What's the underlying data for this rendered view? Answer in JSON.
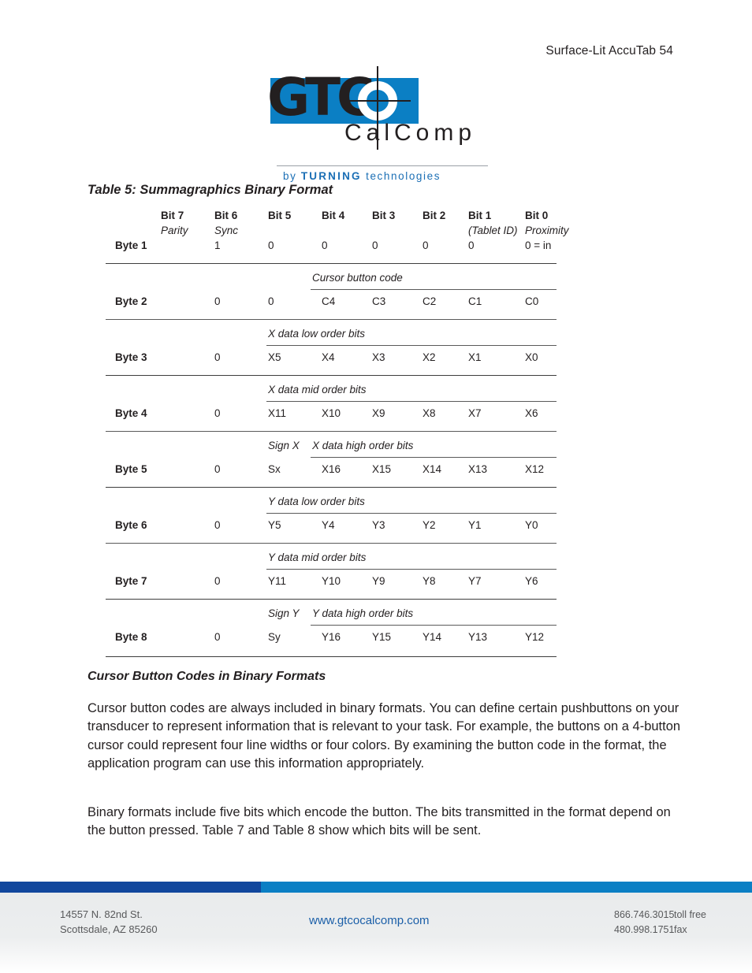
{
  "page_header": "Surface-Lit AccuTab 54",
  "logo": {
    "wordmark": "GTC",
    "subword": "CalComp",
    "tagline_prefix": "by",
    "tagline_strong": "TURNING",
    "tagline_suffix": "technologies",
    "blue": "#0b7fc4",
    "dark": "#231f20",
    "tagline_color": "#1b6fb5"
  },
  "table": {
    "caption": "Table 5: Summagraphics Binary Format",
    "bit_headers": [
      "Bit 7",
      "Bit 6",
      "Bit 5",
      "Bit 4",
      "Bit 3",
      "Bit 2",
      "Bit 1",
      "Bit 0"
    ],
    "bit_sublabels": [
      "Parity",
      "Sync",
      "",
      "",
      "",
      "",
      "(Tablet ID)",
      "Proximity"
    ],
    "rows": [
      {
        "label": "Byte 1",
        "caption": "",
        "values": [
          "",
          "1",
          "0",
          "0",
          "0",
          "0",
          "0",
          "0 = in"
        ]
      },
      {
        "label": "Byte 2",
        "caption": "Cursor button code",
        "values": [
          "",
          "0",
          "0",
          "C4",
          "C3",
          "C2",
          "C1",
          "C0"
        ]
      },
      {
        "label": "Byte 3",
        "caption": "X data low order bits",
        "values": [
          "",
          "0",
          "X5",
          "X4",
          "X3",
          "X2",
          "X1",
          "X0"
        ]
      },
      {
        "label": "Byte 4",
        "caption": "X data mid order bits",
        "values": [
          "",
          "0",
          "X11",
          "X10",
          "X9",
          "X8",
          "X7",
          "X6"
        ]
      },
      {
        "label": "Byte 5",
        "caption_sign": "Sign X",
        "caption": "X data high order bits",
        "values": [
          "",
          "0",
          "Sx",
          "X16",
          "X15",
          "X14",
          "X13",
          "X12"
        ]
      },
      {
        "label": "Byte 6",
        "caption": "Y data low order bits",
        "values": [
          "",
          "0",
          "Y5",
          "Y4",
          "Y3",
          "Y2",
          "Y1",
          "Y0"
        ]
      },
      {
        "label": "Byte 7",
        "caption": "Y data mid order bits",
        "values": [
          "",
          "0",
          "Y11",
          "Y10",
          "Y9",
          "Y8",
          "Y7",
          "Y6"
        ]
      },
      {
        "label": "Byte 8",
        "caption_sign": "Sign Y",
        "caption": "Y data high order bits",
        "values": [
          "",
          "0",
          "Sy",
          "Y16",
          "Y15",
          "Y14",
          "Y13",
          "Y12"
        ]
      }
    ]
  },
  "body": {
    "heading": "Cursor Button Codes in Binary Formats",
    "paragraph_1": "Cursor button codes are always included in binary formats.  You can define certain pushbuttons on your transducer to represent information that is relevant to your task.  For example, the buttons on a 4-button cursor could represent four line widths or four colors.  By examining the button code in the format, the application program can use this information appropriately.",
    "paragraph_2": "Binary formats include five bits which encode the button.  The bits transmitted in the format depend on the button pressed.  Table 7 and Table 8 show which bits will be sent."
  },
  "footer": {
    "address_line_1": "14557 N. 82nd St.",
    "address_line_2": "Scottsdale, AZ 85260",
    "website": "www.gtcocalcomp.com",
    "phone_toll_free_number": "866.746.3015",
    "phone_toll_free_label": "toll free",
    "phone_fax_number": "480.998.1751",
    "phone_fax_label": "fax",
    "band_dark": "#11479d",
    "band_light": "#0b7fc4"
  }
}
